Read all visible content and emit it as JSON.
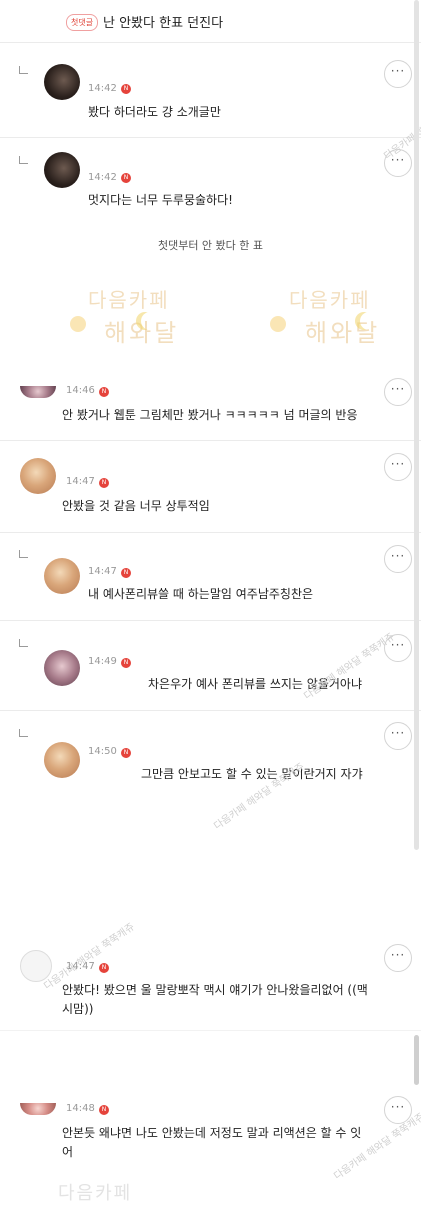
{
  "header": {
    "badge": "첫댓글",
    "title": "난 안봤다 한표 던진다"
  },
  "divider_text": "첫댓부터 안 봤다 한 표",
  "new_badge": "N",
  "more_label": "···",
  "watermark": {
    "logo_line1": "다음카페",
    "logo_line2": "해와달",
    "diagonal": "다음카페 해와달 쭉쭉캐쥬"
  },
  "comments": [
    {
      "time": "14:42",
      "text": "봤다 하더라도 걍 소개글만"
    },
    {
      "time": "14:42",
      "text": "멋지다는 너무 두루뭉술하다!"
    },
    {
      "time": "14:46",
      "text": "안 봤거나 웹툰 그림체만 봤거나 ㅋㅋㅋㅋㅋ 넘 머글의 반응"
    },
    {
      "time": "14:47",
      "text": "안봤을 것 같음 너무 상투적임"
    },
    {
      "time": "14:47",
      "text": "내 예사폰리뷰쓸 때 하는말임 여주남주칭찬은"
    },
    {
      "time": "14:49",
      "text": "차은우가 예사 폰리뷰를 쓰지는 않을거아냐"
    },
    {
      "time": "14:50",
      "text": "그만큼 안보고도 할 수 있는 말이란거지 자갸"
    },
    {
      "time": "14:47",
      "text_line1": "안봤다! 봤으면 울 말랑뽀작 맥시 얘기가 안나왔을리없어 ((맥",
      "text_line2": "시맘))"
    },
    {
      "time": "14:48",
      "text_line1": "안본듯 왜냐면 나도 안봤는데 저정도 말과 리액션은 할 수 잇",
      "text_line2": "어"
    }
  ],
  "colors": {
    "accent_red": "#e5433b",
    "time_gray": "#999999",
    "separator": "#ebebeb",
    "watermark_gold": "#e9c48a"
  }
}
